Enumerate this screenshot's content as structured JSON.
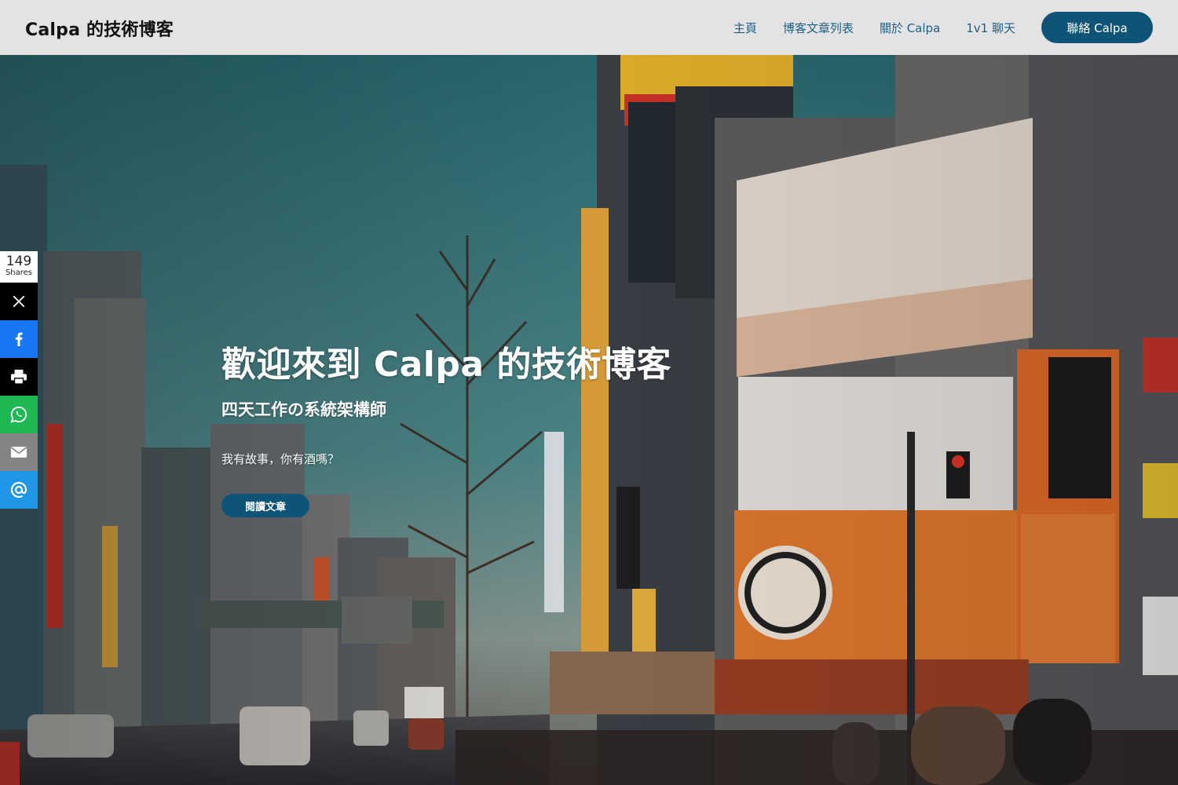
{
  "header": {
    "site_title": "Calpa 的技術博客",
    "nav": [
      {
        "label": "主頁"
      },
      {
        "label": "博客文章列表"
      },
      {
        "label": "關於 Calpa"
      },
      {
        "label": "1v1 聊天"
      }
    ],
    "cta_label": "聯絡 Calpa"
  },
  "hero": {
    "title": "歡迎來到 Calpa 的技術博客",
    "subtitle": "四天工作の系統架構師",
    "tagline": "我有故事，你有酒嗎？",
    "button_label": "閱讀文章"
  },
  "share": {
    "count": "149",
    "count_label": "Shares",
    "buttons": [
      {
        "icon": "x-icon",
        "color": "#000000"
      },
      {
        "icon": "facebook-icon",
        "color": "#1877f2"
      },
      {
        "icon": "print-icon",
        "color": "#000000"
      },
      {
        "icon": "whatsapp-icon",
        "color": "#1fb954"
      },
      {
        "icon": "email-icon",
        "color": "#848484"
      },
      {
        "icon": "at-sign-icon",
        "color": "#1f97e6"
      }
    ]
  },
  "colors": {
    "header_bg": "#e3e3e3",
    "nav_link": "#1c5f86",
    "accent": "#0d5477",
    "sky": "#2f6f73"
  }
}
